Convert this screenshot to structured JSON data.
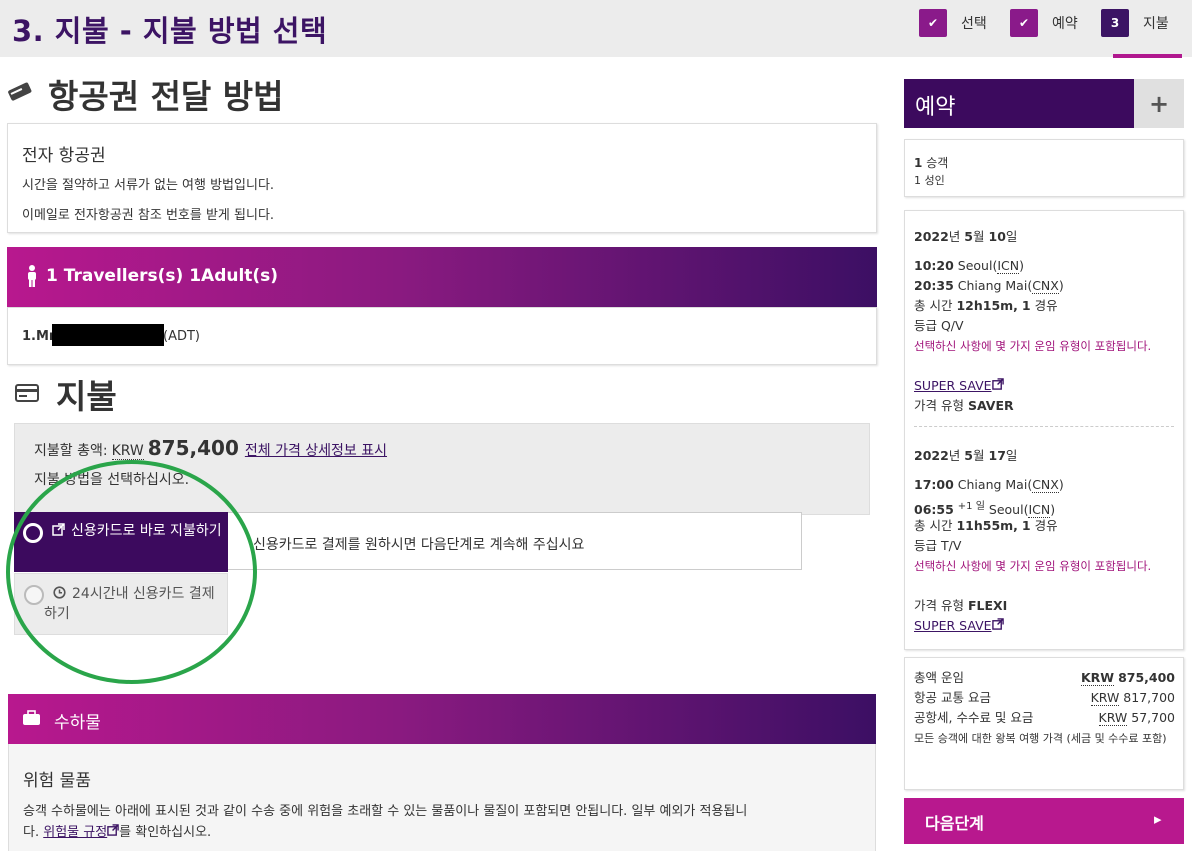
{
  "header": {
    "title": "3. 지불 - 지불 방법 선택",
    "steps": [
      {
        "box": "✔",
        "label": "선택"
      },
      {
        "box": "✔",
        "label": "예약"
      },
      {
        "box": "3",
        "label": "지불"
      }
    ]
  },
  "ticket_delivery": {
    "heading": "항공권 전달 방법",
    "icon": "ticket-icon",
    "option_title": "전자 항공권",
    "line1": "시간을 절약하고 서류가 없는 여행 방법입니다.",
    "line2": "이메일로 전자항공권 참조 번호를 받게 됩니다."
  },
  "travellers": {
    "bar_label": "1 Travellers(s) 1Adult(s)",
    "icon": "person-icon",
    "item_prefix": "1.Mr.",
    "item_suffix": "(ADT)"
  },
  "payment": {
    "heading": "지불",
    "icon": "credit-card-icon",
    "total_label": "지불할 총액:",
    "currency": "KRW",
    "amount": "875,400",
    "detail_link": "전체 가격 상세정보 표시",
    "choose_label": "지불 방법을 선택하십시오.",
    "options": [
      {
        "label": "신용카드로 바로 지불하기",
        "icon": "external-link-icon",
        "selected": true
      },
      {
        "label": "24시간내 신용카드 결제하기",
        "icon": "clock-icon",
        "selected": false
      }
    ],
    "option_note": "신용카드로 결제를 원하시면 다음단계로 계속해 주십시요"
  },
  "baggage": {
    "bar_label": "수하물",
    "icon": "briefcase-icon",
    "title": "위험 물품",
    "text1": "승객 수하물에는 아래에 표시된 것과 같이 수송 중에 위험을 초래할 수 있는 물품이나 물질이 포함되면 안됩니다. 일부 예외가 적용됩니",
    "text2_prefix": "다.",
    "text2_link": "위험물 규정",
    "text2_suffix": "를 확인하십시오."
  },
  "sidebar": {
    "title": "예약",
    "expand_symbol": "+",
    "passengers": {
      "count": "1",
      "count_label": "승객",
      "detail": "1 성인"
    },
    "flights": [
      {
        "date_year": "2022",
        "date_year_unit": "년",
        "date_month": "5",
        "date_month_unit": "월",
        "date_day": "10",
        "date_day_unit": "일",
        "dep_time": "10:20",
        "dep_city": "Seoul",
        "dep_code": "ICN",
        "arr_time": "20:35",
        "arr_city": "Chiang Mai",
        "arr_code": "CNX",
        "arr_sup": "",
        "duration_label": "총 시간",
        "duration": "12h15m,",
        "stops": "1",
        "stops_label": "경유",
        "class_label": "등급 Q/V",
        "fare_note": "선택하신 사항에 몇 가지 운임 유형이 포함됩니다.",
        "link1": "SUPER SAVE",
        "fare_type_label": "가격 유형",
        "fare_type": "SAVER"
      },
      {
        "date_year": "2022",
        "date_year_unit": "년",
        "date_month": "5",
        "date_month_unit": "월",
        "date_day": "17",
        "date_day_unit": "일",
        "dep_time": "17:00",
        "dep_city": "Chiang Mai",
        "dep_code": "CNX",
        "arr_time": "06:55",
        "arr_city": "Seoul",
        "arr_code": "ICN",
        "arr_sup": "+1 일",
        "duration_label": "총 시간",
        "duration": "11h55m,",
        "stops": "1",
        "stops_label": "경유",
        "class_label": "등급 T/V",
        "fare_note": "선택하신 사항에 몇 가지 운임 유형이 포함됩니다.",
        "fare_type_label": "가격 유형",
        "fare_type": "FLEXI",
        "link1": "SUPER SAVE"
      }
    ],
    "totals": {
      "total_label": "총액 운임",
      "total_currency": "KRW",
      "total_amount": "875,400",
      "fare_label": "항공 교통 요금",
      "fare_currency": "KRW",
      "fare_amount": "817,700",
      "tax_label": "공항세, 수수료 및 요금",
      "tax_currency": "KRW",
      "tax_amount": "57,700",
      "note": "모든 승객에 대한 왕복 여행 가격 (세금 및 수수료 포함)"
    },
    "next_button": "다음단계",
    "next_arrow": "▸"
  },
  "colors": {
    "brand_purple": "#3c1464",
    "brand_magenta": "#b8188e",
    "highlight_circle": "#2aa54a"
  }
}
